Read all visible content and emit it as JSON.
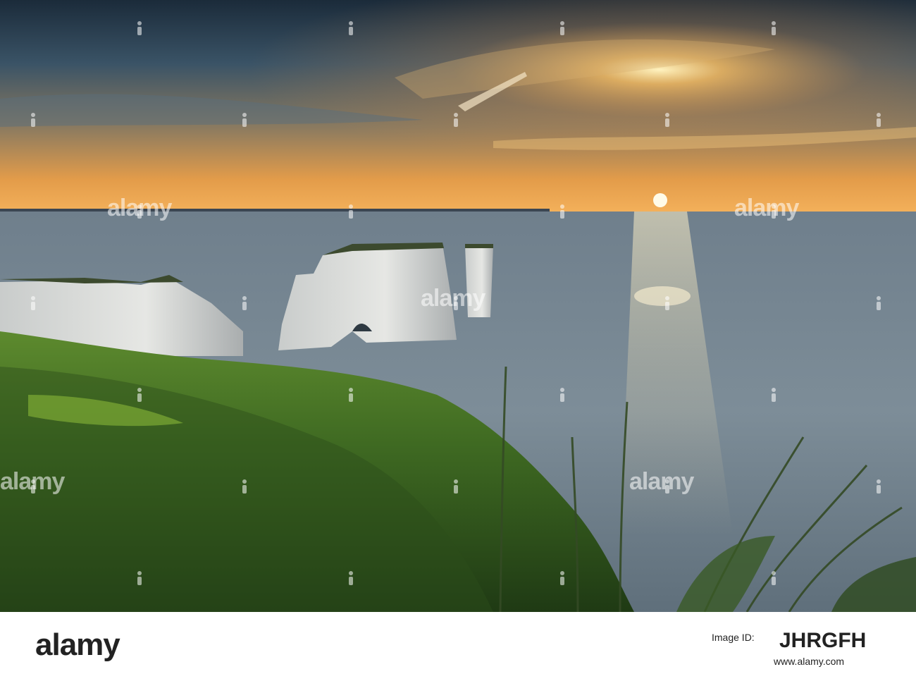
{
  "watermark": {
    "word": "alamy"
  },
  "footer": {
    "logo": "alamy",
    "image_id_label": "Image ID:",
    "image_id": "JHRGFH",
    "url": "www.alamy.com"
  }
}
